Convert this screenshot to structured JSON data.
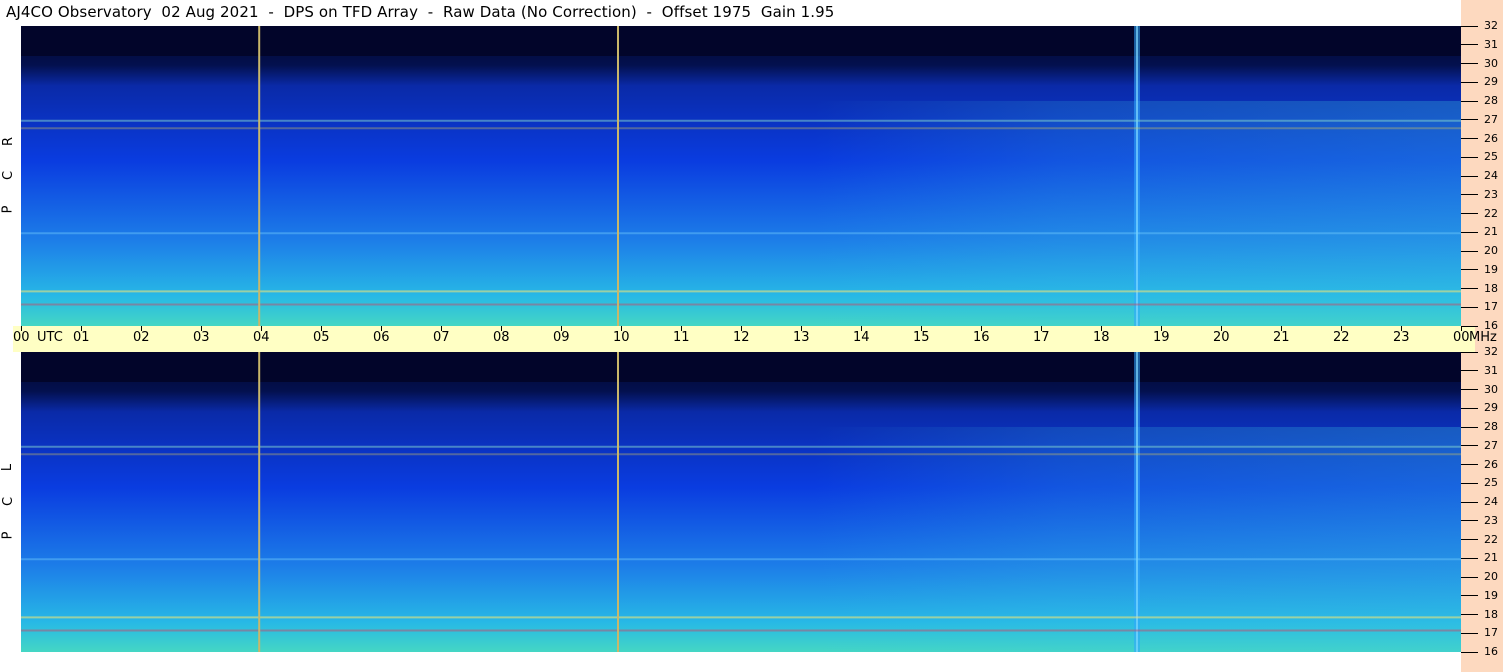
{
  "title": "AJ4CO Observatory  02 Aug 2021  -  DPS on TFD Array  -  Raw Data (No Correction)  -  Offset 1975  Gain 1.95",
  "colors": {
    "spectrogram_dark": "#02052a",
    "spectrogram_mid": "#0a3ce0",
    "spectrogram_low": "#27b8e6",
    "axis_band": "#ffffc4",
    "freq_bar": "#fdd9bf",
    "marker_line": "#c9b76a"
  },
  "panels": [
    {
      "id": "rcp",
      "letters": [
        "R",
        "C",
        "P"
      ]
    },
    {
      "id": "lcp",
      "letters": [
        "L",
        "C",
        "P"
      ]
    }
  ],
  "chart_data": {
    "type": "heatmap",
    "x_axis": {
      "unit_label": "UTC",
      "ticks": [
        "00",
        "01",
        "02",
        "03",
        "04",
        "05",
        "06",
        "07",
        "08",
        "09",
        "10",
        "11",
        "12",
        "13",
        "14",
        "15",
        "16",
        "17",
        "18",
        "19",
        "20",
        "21",
        "22",
        "23",
        "00"
      ],
      "range_hours": [
        0,
        24
      ]
    },
    "y_axis": {
      "unit_label": "MHz",
      "ticks": [
        "16",
        "17",
        "18",
        "19",
        "20",
        "21",
        "22",
        "23",
        "24",
        "25",
        "26",
        "27",
        "28",
        "29",
        "30",
        "31",
        "32"
      ],
      "range_mhz": [
        16,
        32
      ]
    },
    "series": [
      {
        "name": "RCP"
      },
      {
        "name": "LCP"
      }
    ],
    "time_markers_utc_hours": [
      3.97,
      9.95
    ],
    "strong_activity_utc_hours": [
      18.6
    ]
  }
}
